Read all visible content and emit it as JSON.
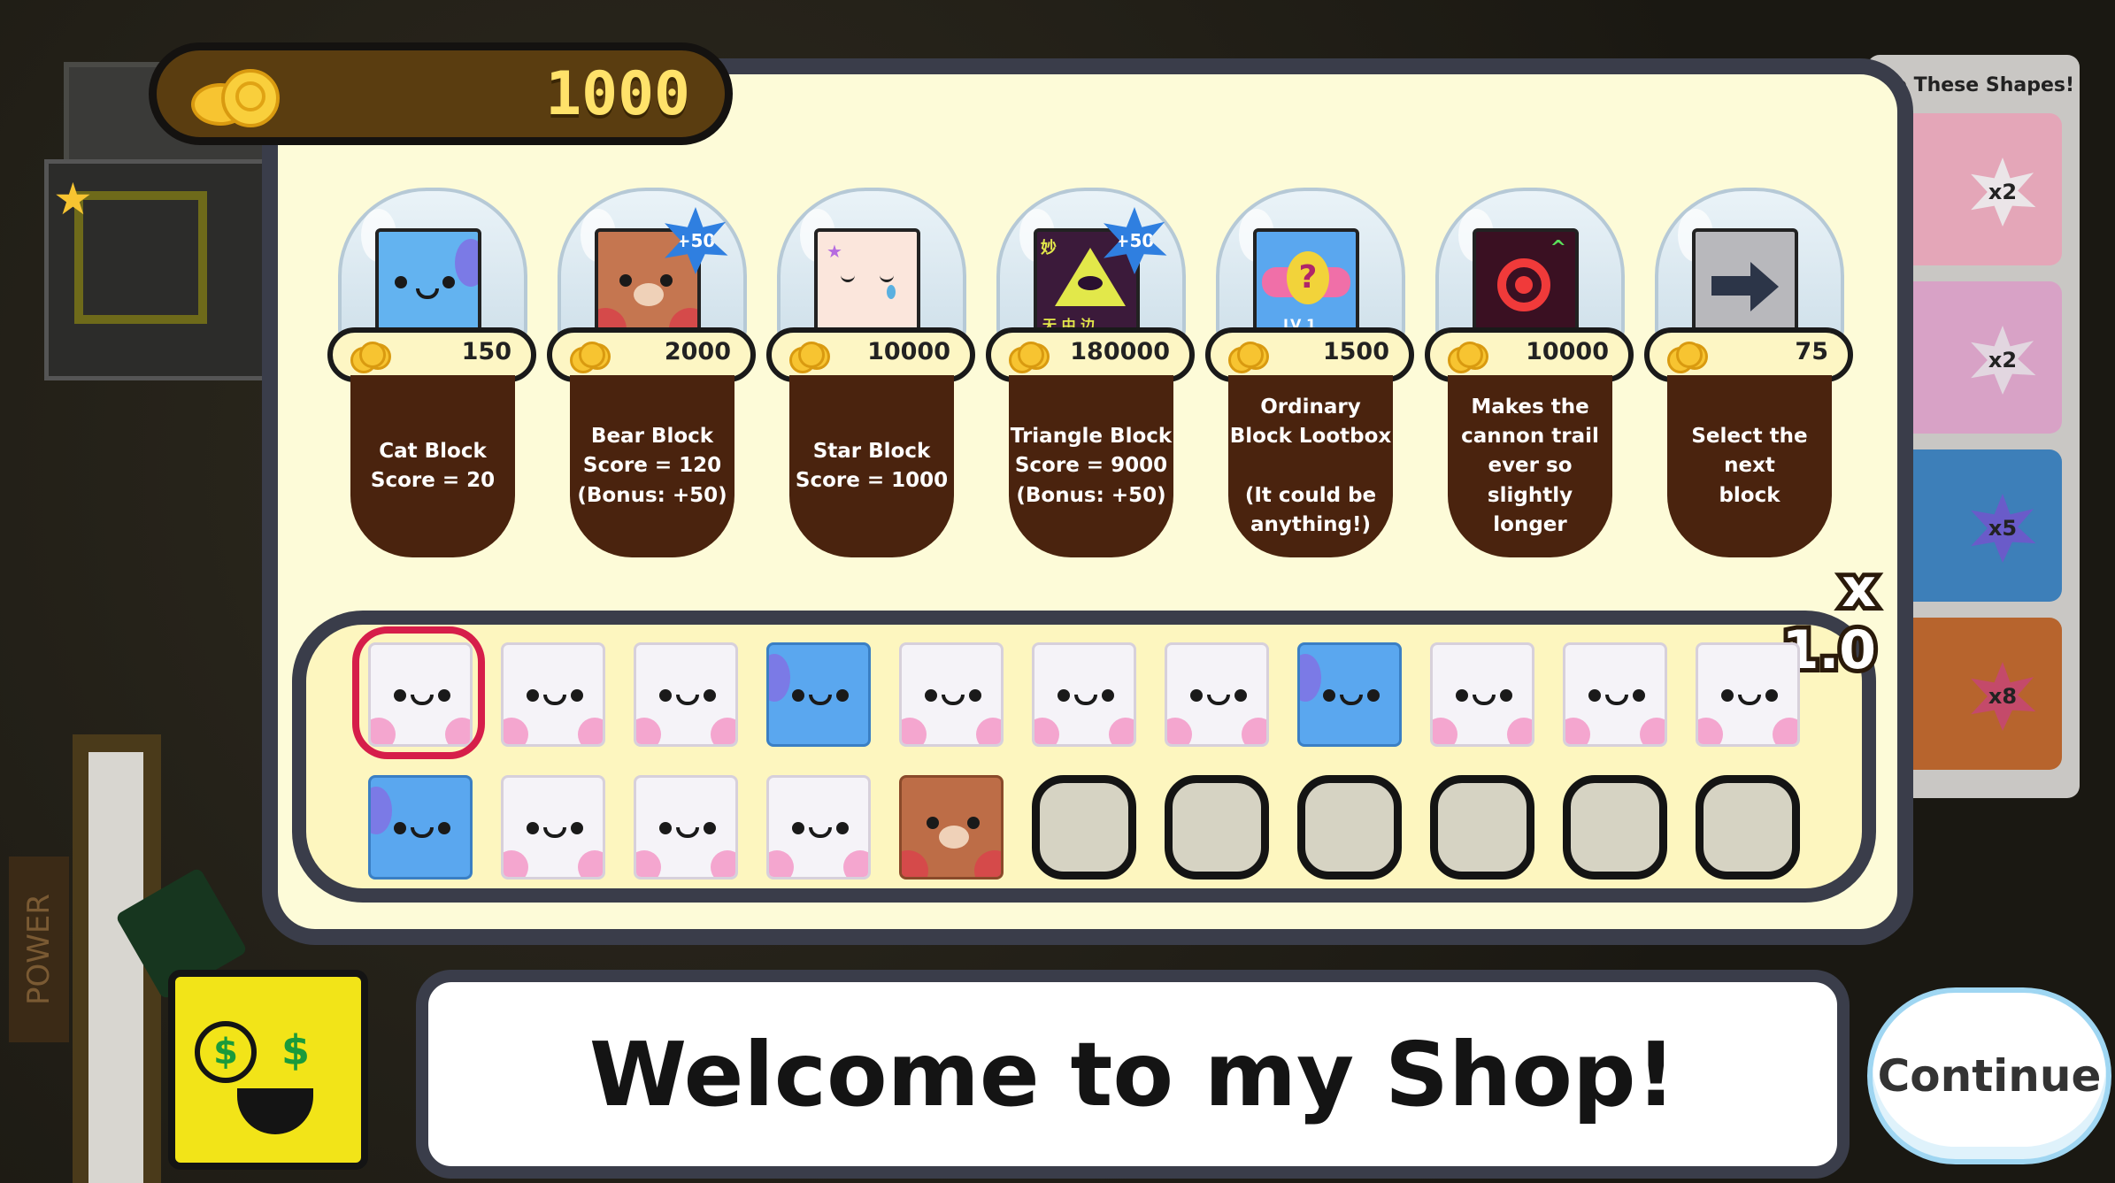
{
  "currency": {
    "amount": "1000",
    "icon": "gold-coins-icon"
  },
  "shop_items": [
    {
      "id": "cat",
      "block_style": "cat",
      "price": "150",
      "description": "Cat Block\nScore = 20",
      "badge": ""
    },
    {
      "id": "bear",
      "block_style": "bear",
      "price": "2000",
      "description": "Bear Block\nScore = 120\n(Bonus: +50)",
      "badge": "+50"
    },
    {
      "id": "star",
      "block_style": "star",
      "price": "10000",
      "description": "Star Block\nScore = 1000",
      "badge": ""
    },
    {
      "id": "triangle",
      "block_style": "triangle",
      "price": "180000",
      "description": "Triangle Block\nScore = 9000\n(Bonus: +50)",
      "badge": "+50"
    },
    {
      "id": "lootbox",
      "block_style": "lootbox",
      "price": "1500",
      "description": "Ordinary\nBlock Lootbox\n\n(It could be\nanything!)",
      "badge": ""
    },
    {
      "id": "cannon",
      "block_style": "cannon",
      "price": "10000",
      "description": "Makes the\ncannon trail\never so slightly\nlonger",
      "badge": ""
    },
    {
      "id": "select",
      "block_style": "arrow",
      "price": "75",
      "description": "Select the next\nblock",
      "badge": ""
    }
  ],
  "triangle_art_text": {
    "left": "妙",
    "bottom": "无 中 边"
  },
  "lootbox_art_text": {
    "mark": "?",
    "level": "LV 1"
  },
  "inventory": {
    "multiplier": "x 1.0",
    "row1": [
      "white",
      "white",
      "white",
      "blue",
      "white",
      "white",
      "white",
      "blue",
      "white",
      "white",
      "white"
    ],
    "row2": [
      "blue",
      "white",
      "white",
      "white",
      "bear",
      "empty",
      "empty",
      "empty",
      "empty",
      "empty",
      "empty"
    ],
    "selected_index": 0
  },
  "dialog": {
    "text": "Welcome to my Shop!"
  },
  "continue_button": {
    "label": "Continue"
  },
  "side_panel": {
    "title": "ke These Shapes!",
    "multipliers": [
      "x2",
      "x2",
      "x5",
      "x8"
    ]
  },
  "background": {
    "power_label": "POWER"
  },
  "colors": {
    "panel_bg": "#fdfbd8",
    "frame": "#3a3d4a",
    "desc_bg": "#4a230e",
    "coin_bar": "#5a3d10",
    "coin_text": "#ffe26a",
    "selected": "#d61e4a"
  }
}
